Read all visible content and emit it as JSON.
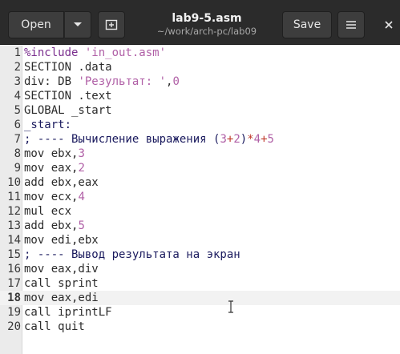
{
  "window": {
    "title": "lab9-5.asm",
    "subtitle": "~/work/arch-pc/lab09",
    "open_label": "Open",
    "save_label": "Save",
    "colors": {
      "titlebar": "#2b2b2b",
      "editor_bg": "#ffffff",
      "gutter_bg": "#ebebeb"
    }
  },
  "editor": {
    "current_line": 18,
    "lines": [
      {
        "n": "1",
        "tokens": [
          {
            "t": "%include ",
            "c": "directive"
          },
          {
            "t": "'in_out.asm'",
            "c": "string"
          }
        ]
      },
      {
        "n": "2",
        "tokens": [
          {
            "t": "SECTION .data",
            "c": ""
          }
        ]
      },
      {
        "n": "3",
        "tokens": [
          {
            "t": "div: DB ",
            "c": ""
          },
          {
            "t": "'Результат: '",
            "c": "string"
          },
          {
            "t": ",",
            "c": ""
          },
          {
            "t": "0",
            "c": "num"
          }
        ]
      },
      {
        "n": "4",
        "tokens": [
          {
            "t": "SECTION .text",
            "c": ""
          }
        ]
      },
      {
        "n": "5",
        "tokens": [
          {
            "t": "GLOBAL _start",
            "c": ""
          }
        ]
      },
      {
        "n": "6",
        "tokens": [
          {
            "t": "_start:",
            "c": "label"
          }
        ]
      },
      {
        "n": "7",
        "tokens": [
          {
            "t": "; ---- Вычисление выражения (",
            "c": "comment"
          },
          {
            "t": "3",
            "c": "num"
          },
          {
            "t": "+",
            "c": "op"
          },
          {
            "t": "2",
            "c": "num"
          },
          {
            "t": ")",
            "c": "comment"
          },
          {
            "t": "*",
            "c": "op"
          },
          {
            "t": "4",
            "c": "num"
          },
          {
            "t": "+",
            "c": "op"
          },
          {
            "t": "5",
            "c": "num"
          }
        ]
      },
      {
        "n": "8",
        "tokens": [
          {
            "t": "mov ebx,",
            "c": ""
          },
          {
            "t": "3",
            "c": "num"
          }
        ]
      },
      {
        "n": "9",
        "tokens": [
          {
            "t": "mov eax,",
            "c": ""
          },
          {
            "t": "2",
            "c": "num"
          }
        ]
      },
      {
        "n": "10",
        "tokens": [
          {
            "t": "add ebx,eax",
            "c": ""
          }
        ]
      },
      {
        "n": "11",
        "tokens": [
          {
            "t": "mov ecx,",
            "c": ""
          },
          {
            "t": "4",
            "c": "num"
          }
        ]
      },
      {
        "n": "12",
        "tokens": [
          {
            "t": "mul ecx",
            "c": ""
          }
        ]
      },
      {
        "n": "13",
        "tokens": [
          {
            "t": "add ebx,",
            "c": ""
          },
          {
            "t": "5",
            "c": "num"
          }
        ]
      },
      {
        "n": "14",
        "tokens": [
          {
            "t": "mov edi,ebx",
            "c": ""
          }
        ]
      },
      {
        "n": "15",
        "tokens": [
          {
            "t": "; ---- Вывод результата на экран",
            "c": "comment"
          }
        ]
      },
      {
        "n": "16",
        "tokens": [
          {
            "t": "mov eax,div",
            "c": ""
          }
        ]
      },
      {
        "n": "17",
        "tokens": [
          {
            "t": "call sprint",
            "c": ""
          }
        ]
      },
      {
        "n": "18",
        "tokens": [
          {
            "t": "mov eax,edi",
            "c": ""
          }
        ]
      },
      {
        "n": "19",
        "tokens": [
          {
            "t": "call iprintLF",
            "c": ""
          }
        ]
      },
      {
        "n": "20",
        "tokens": [
          {
            "t": "call quit",
            "c": ""
          }
        ]
      }
    ]
  }
}
